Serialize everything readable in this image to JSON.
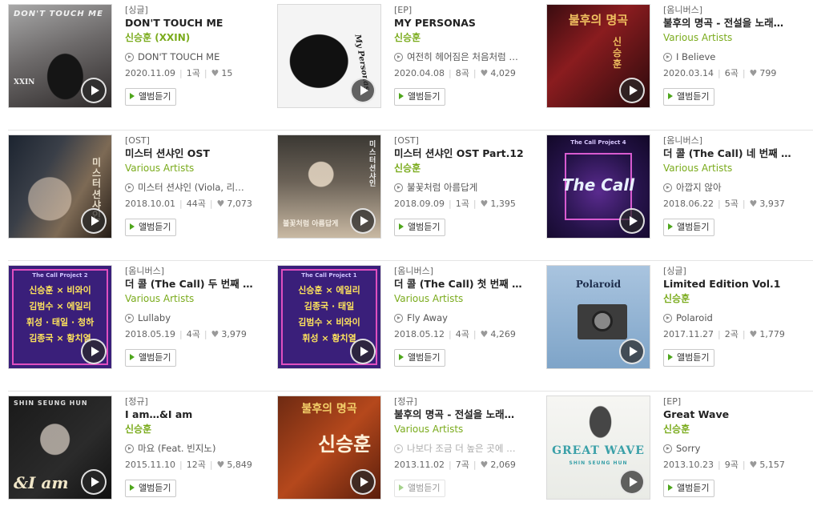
{
  "listen_label": "앨범듣기",
  "play_icon": "play-icon",
  "colors": {
    "artist_link": "#7aab1c",
    "listen_icon": "#4fa61d",
    "divider": "#e4e4e4"
  },
  "albums": [
    {
      "type": "[싱글]",
      "title": "DON'T TOUCH ME",
      "artist": "신승훈 (XXIN)",
      "track": "DON'T TOUCH ME",
      "date": "2020.11.09",
      "tracks": "1곡",
      "likes": "15",
      "cover_text": "DON'T TOUCH ME",
      "cover_sub": "XXIN"
    },
    {
      "type": "[EP]",
      "title": "MY PERSONAS",
      "artist": "신승훈",
      "track": "여전히 헤어짐은 처음처럼 …",
      "date": "2020.04.08",
      "tracks": "8곡",
      "likes": "4,029",
      "cover_text": "My Personas"
    },
    {
      "type": "[옴니버스]",
      "title": "불후의 명곡 - 전설을 노래…",
      "artist": "Various Artists",
      "track": "I Believe",
      "date": "2020.03.14",
      "tracks": "6곡",
      "likes": "799",
      "cover_text": "불후의 명곡",
      "cover_sub": "신승훈"
    },
    {
      "type": "[OST]",
      "title": "미스터 션샤인 OST",
      "artist": "Various Artists",
      "track": "미스터 션샤인 (Viola, 리…",
      "date": "2018.10.01",
      "tracks": "44곡",
      "likes": "7,073",
      "cover_text": "미스터 션샤인"
    },
    {
      "type": "[OST]",
      "title": "미스터 션샤인 OST Part.12",
      "artist": "신승훈",
      "track": "불꽃처럼 아름답게",
      "date": "2018.09.09",
      "tracks": "1곡",
      "likes": "1,395",
      "cover_text": "미스터 션샤인",
      "cover_sub": "불꽃처럼 아름답게"
    },
    {
      "type": "[옴니버스]",
      "title": "더 콜 (The Call) 네 번째 …",
      "artist": "Various Artists",
      "track": "아깝지 않아",
      "date": "2018.06.22",
      "tracks": "5곡",
      "likes": "3,937",
      "cover_text": "The Call",
      "cover_sub": "The Call Project 4"
    },
    {
      "type": "[옴니버스]",
      "title": "더 콜 (The Call) 두 번째 …",
      "artist": "Various Artists",
      "track": "Lullaby",
      "date": "2018.05.19",
      "tracks": "4곡",
      "likes": "3,979",
      "cover_sub": "The Call Project 2",
      "cover_lines": [
        "신승훈 × 비와이",
        "김범수 × 에일리",
        "휘성 · 태일 · 청하",
        "김종국 × 황치열"
      ]
    },
    {
      "type": "[옴니버스]",
      "title": "더 콜 (The Call) 첫 번째 …",
      "artist": "Various Artists",
      "track": "Fly Away",
      "date": "2018.05.12",
      "tracks": "4곡",
      "likes": "4,269",
      "cover_sub": "The Call Project 1",
      "cover_lines": [
        "신승훈 × 에일리",
        "김종국 · 태일",
        "김범수 × 비와이",
        "휘성 × 황치열"
      ]
    },
    {
      "type": "[싱글]",
      "title": "Limited Edition Vol.1",
      "artist": "신승훈",
      "track": "Polaroid",
      "date": "2017.11.27",
      "tracks": "2곡",
      "likes": "1,779",
      "cover_text": "Polaroid"
    },
    {
      "type": "[정규]",
      "title": "I am…&I am",
      "artist": "신승훈",
      "track": "마요 (Feat. 빈지노)",
      "date": "2015.11.10",
      "tracks": "12곡",
      "likes": "5,849",
      "cover_text": "SHIN SEUNG HUN",
      "cover_sub": "&I am"
    },
    {
      "type": "[정규]",
      "title": "불후의 명곡 - 전설을 노래…",
      "artist": "Various Artists",
      "track": "나보다 조금 더 높은 곳에 …",
      "date": "2013.11.02",
      "tracks": "7곡",
      "likes": "2,069",
      "cover_text": "불후의 명곡",
      "cover_sub": "신승훈"
    },
    {
      "type": "[EP]",
      "title": "Great Wave",
      "artist": "신승훈",
      "track": "Sorry",
      "date": "2013.10.23",
      "tracks": "9곡",
      "likes": "5,157",
      "cover_text": "GREAT WAVE",
      "cover_sub": "SHIN SEUNG HUN"
    }
  ]
}
